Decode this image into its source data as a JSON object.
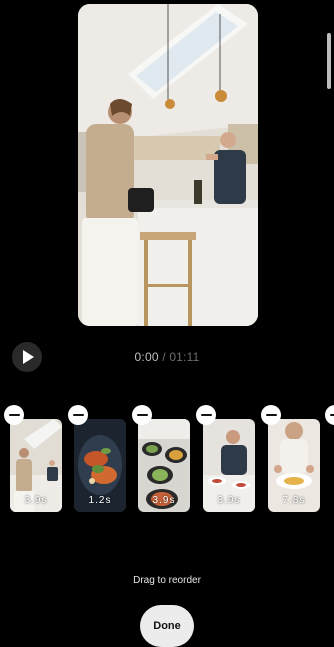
{
  "preview": {
    "label": "video-preview"
  },
  "player": {
    "current_time": "0:00",
    "separator": " / ",
    "total_time": "01:11"
  },
  "clips": [
    {
      "duration": "3.9s"
    },
    {
      "duration": "1.2s"
    },
    {
      "duration": "3.9s"
    },
    {
      "duration": "3.9s"
    },
    {
      "duration": "7.8s"
    }
  ],
  "hint": "Drag to reorder",
  "done_label": "Done",
  "icons": {
    "play": "play-icon",
    "remove": "minus-icon"
  },
  "colors": {
    "background": "#000000",
    "done_button": "#ececec",
    "remove_badge": "#ffffff"
  }
}
